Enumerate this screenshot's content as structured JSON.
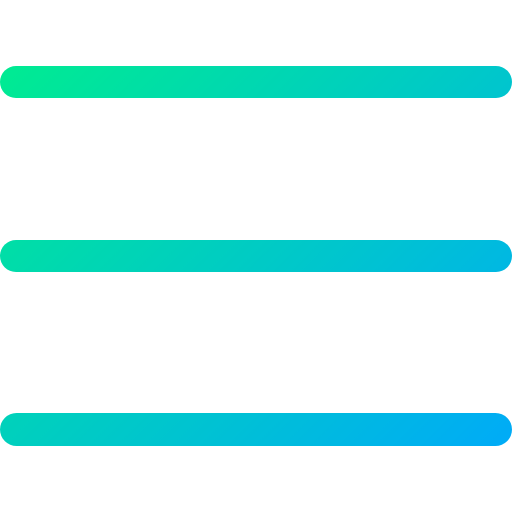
{
  "icon": {
    "name": "hamburger-menu-icon",
    "line_count": 3,
    "gradient": {
      "start_color": "#00f08a",
      "end_color": "#00a6ff"
    }
  }
}
